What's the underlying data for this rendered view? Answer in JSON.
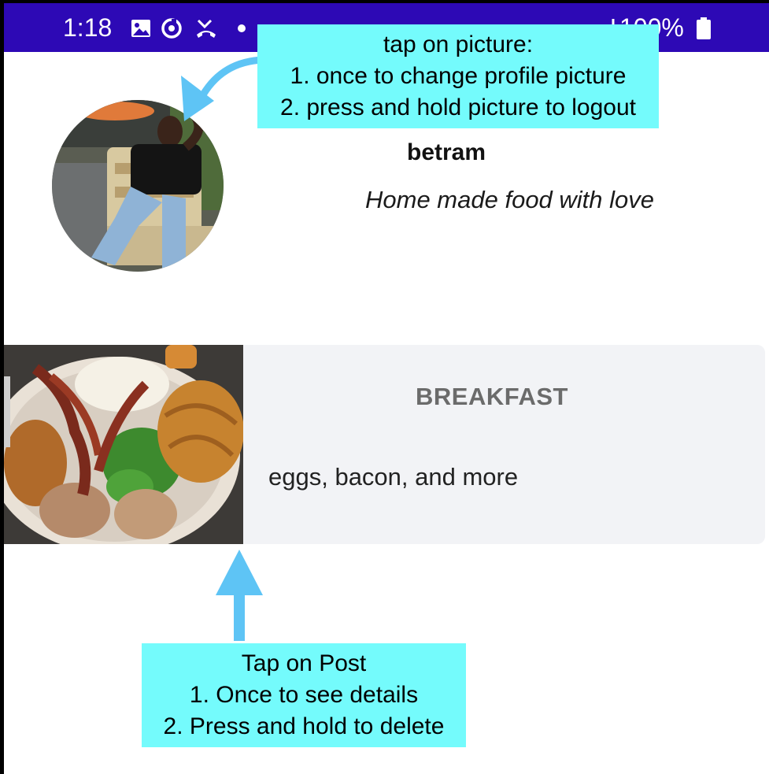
{
  "status_bar": {
    "time": "1:18",
    "battery_text": "100%",
    "background": "#2d09b5",
    "icons": [
      "image-icon",
      "sync-icon",
      "missed-call-icon",
      "dot-icon",
      "signal-icon",
      "battery-icon"
    ]
  },
  "profile": {
    "username": "betram",
    "bio": "Home made food with love",
    "avatar_icon": "profile-photo"
  },
  "post": {
    "title": "BREAKFAST",
    "description": "eggs, bacon, and more",
    "image": "breakfast-plate-photo"
  },
  "annotations": {
    "top": {
      "line1": "tap on picture:",
      "line2": "1. once to change profile picture",
      "line3": "2. press and hold picture to logout"
    },
    "bottom": {
      "line1": "Tap on Post",
      "line2": "1. Once to see details",
      "line3": "2. Press and hold to delete"
    },
    "color": "#74fbfc",
    "arrow_color": "#5ec4f5"
  }
}
